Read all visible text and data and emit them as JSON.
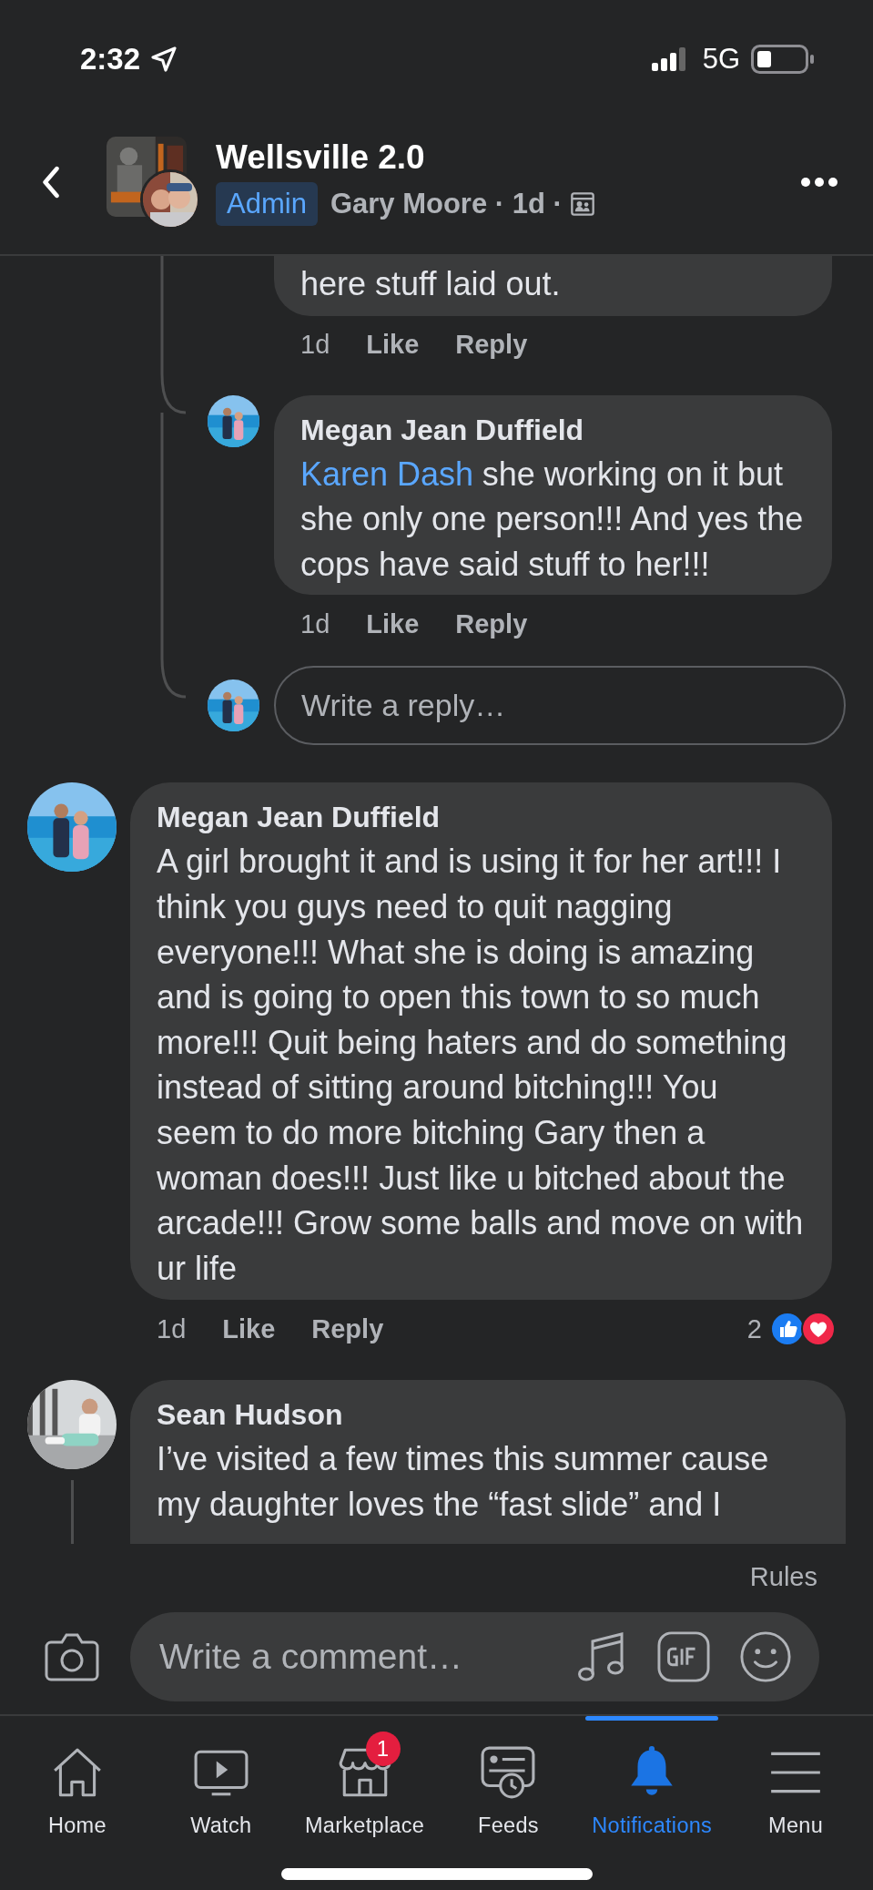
{
  "status_bar": {
    "time": "2:32",
    "network": "5G"
  },
  "header": {
    "title": "Wellsville 2.0",
    "badge": "Admin",
    "meta": "Gary Moore · 1d ·"
  },
  "replies": [
    {
      "text": "here stuff laid out.",
      "time": "1d",
      "like": "Like",
      "reply": "Reply"
    },
    {
      "author": "Megan Jean Duffield",
      "mention": "Karen Dash",
      "text": "she working on it but she only one person!!! And yes the cops have said stuff to her!!!",
      "time": "1d",
      "like": "Like",
      "reply": "Reply"
    }
  ],
  "reply_field": {
    "placeholder": "Write a reply…"
  },
  "comments": [
    {
      "author": "Megan Jean Duffield",
      "text": "A girl brought it and is using it for her art!!! I think you guys need to quit nagging everyone!!! What she is doing is amazing and is going to open this town to so much more!!! Quit being haters and do something instead of sitting around bitching!!! You seem to do more bitching Gary then a woman does!!! Just like u bitched about the arcade!!! Grow some balls and move on with ur life",
      "time": "1d",
      "like": "Like",
      "reply": "Reply",
      "reaction_count": "2"
    },
    {
      "author": "Sean Hudson",
      "text": "I’ve visited a few times this summer cause my daughter loves the “fast slide” and I"
    }
  ],
  "rules": "Rules",
  "composer": {
    "placeholder": "Write a comment…"
  },
  "tabs": [
    {
      "label": "Home",
      "selected": false
    },
    {
      "label": "Watch",
      "selected": false
    },
    {
      "label": "Marketplace",
      "selected": false,
      "badge": "1"
    },
    {
      "label": "Feeds",
      "selected": false
    },
    {
      "label": "Notifications",
      "selected": true
    },
    {
      "label": "Menu",
      "selected": false
    }
  ]
}
